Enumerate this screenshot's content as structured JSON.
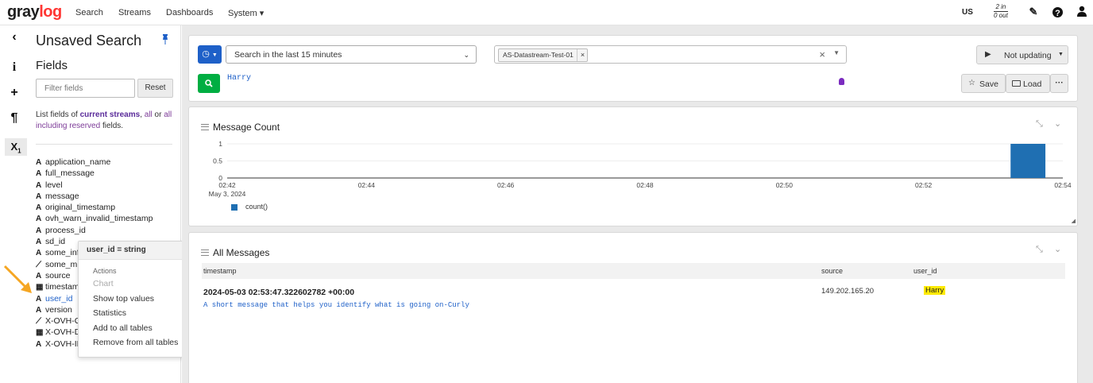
{
  "navbar": {
    "logo_part1": "gray",
    "logo_part2": "log",
    "links": [
      "Search",
      "Streams",
      "Dashboards",
      "System ▾"
    ],
    "region": "US",
    "throughput_in": "2 in",
    "throughput_out": "0 out"
  },
  "sidebar": {
    "title": "Unsaved Search",
    "fields_heading": "Fields",
    "filter_placeholder": "Filter fields",
    "reset_label": "Reset",
    "desc_prefix": "List fields of ",
    "desc_current": "current streams",
    "desc_sep1": ", ",
    "desc_all": "all",
    "desc_or": " or ",
    "desc_reserved": "all including reserved",
    "desc_suffix": " fields.",
    "fields": [
      {
        "type": "A",
        "name": "application_name"
      },
      {
        "type": "A",
        "name": "full_message"
      },
      {
        "type": "A",
        "name": "level"
      },
      {
        "type": "A",
        "name": "message"
      },
      {
        "type": "A",
        "name": "original_timestamp"
      },
      {
        "type": "A",
        "name": "ovh_warn_invalid_timestamp"
      },
      {
        "type": "A",
        "name": "process_id"
      },
      {
        "type": "A",
        "name": "sd_id"
      },
      {
        "type": "A",
        "name": "some_inf"
      },
      {
        "type": "chart",
        "name": "some_m"
      },
      {
        "type": "A",
        "name": "source"
      },
      {
        "type": "cal",
        "name": "timestam"
      },
      {
        "type": "A",
        "name": "user_id"
      },
      {
        "type": "A",
        "name": "version"
      },
      {
        "type": "chart",
        "name": "X-OVH-C"
      },
      {
        "type": "cal",
        "name": "X-OVH-D"
      },
      {
        "type": "A",
        "name": "X-OVH-IN"
      }
    ]
  },
  "popover": {
    "title": "user_id = string",
    "actions_heading": "Actions",
    "items": [
      "Chart",
      "Show top values",
      "Statistics",
      "Add to all tables",
      "Remove from all tables"
    ]
  },
  "search": {
    "timerange": "Search in the last 15 minutes",
    "stream": "AS-Datastream-Test-01",
    "query": "Harry",
    "refresh": "Not updating",
    "save": "Save",
    "load": "Load"
  },
  "message_count": {
    "title": "Message Count",
    "legend": "count()"
  },
  "chart_data": {
    "type": "bar",
    "title": "Message Count",
    "x": [
      "02:42",
      "02:44",
      "02:46",
      "02:48",
      "02:50",
      "02:52",
      "02:54"
    ],
    "x_sublabel": "May 3, 2024",
    "y_ticks": [
      "1",
      "0.5",
      "0"
    ],
    "ylim": [
      0,
      1
    ],
    "series": [
      {
        "name": "count()",
        "points": [
          {
            "x": "02:53:30",
            "y": 1
          }
        ]
      }
    ],
    "legend_position": "bottom-left",
    "bar_color": "#1f6fb2"
  },
  "messages": {
    "title": "All Messages",
    "columns": [
      "timestamp",
      "source",
      "user_id"
    ],
    "rows": [
      {
        "timestamp": "2024-05-03 02:53:47.322602782 +00:00",
        "source": "149.202.165.20",
        "user_id": "Harry",
        "message": "A short message that helps you identify what is going on-Curly"
      }
    ]
  }
}
